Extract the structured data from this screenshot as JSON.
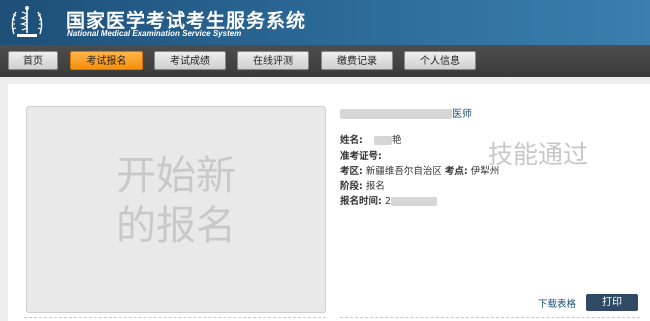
{
  "header": {
    "title": "国家医学考试考生服务系统",
    "subtitle": "National Medical Examination Service System"
  },
  "nav": {
    "items": [
      {
        "label": "首页",
        "active": false
      },
      {
        "label": "考试报名",
        "active": true
      },
      {
        "label": "考试成绩",
        "active": false
      },
      {
        "label": "在线评测",
        "active": false
      },
      {
        "label": "缴费记录",
        "active": false
      },
      {
        "label": "个人信息",
        "active": false
      }
    ]
  },
  "photo_placeholder": {
    "line1": "开始新",
    "line2": "的报名"
  },
  "info": {
    "exam_type_suffix": "医师",
    "name_label": "姓名:",
    "name_value_tail": "艳",
    "id_label": "准考证号:",
    "region_label": "考区:",
    "region_value": "新疆维吾尔自治区",
    "site_label": "考点:",
    "site_value": "伊犁州",
    "stage_label": "阶段:",
    "stage_value": "报名",
    "time_label": "报名时间:",
    "time_value_head": "2"
  },
  "watermark": "技能通过",
  "actions": {
    "download": "下载表格",
    "print": "打印"
  },
  "colors": {
    "header_bg": "#2a6694",
    "nav_bg": "#3a3a3a",
    "active_tab": "#f58f0a",
    "print_btn": "#2f4a64",
    "link": "#1d4f77"
  }
}
